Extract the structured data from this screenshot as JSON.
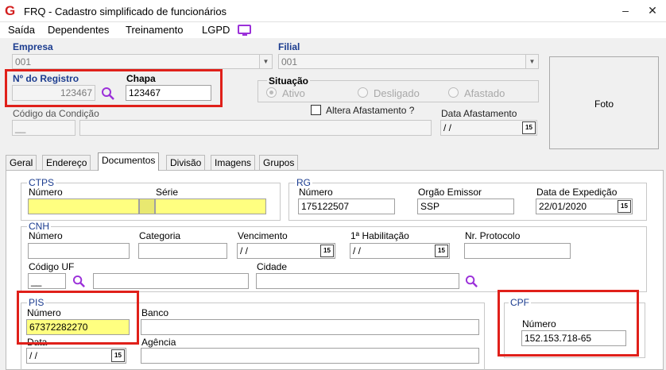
{
  "window": {
    "title": "FRQ - Cadastro simplificado de funcionários",
    "minimize": "–",
    "close": "✕"
  },
  "menu": [
    "Saída",
    "Dependentes",
    "Treinamento",
    "LGPD"
  ],
  "empresa": {
    "label": "Empresa",
    "value": "001"
  },
  "filial": {
    "label": "Filial",
    "value": "001"
  },
  "registro": {
    "label": "Nº do Registro",
    "value": "123467"
  },
  "chapa": {
    "label": "Chapa",
    "value": "123467"
  },
  "situacao": {
    "label": "Situação",
    "options": [
      "Ativo",
      "Desligado",
      "Afastado"
    ],
    "selected": "Ativo"
  },
  "codigo_condicao": {
    "label": "Código da Condição",
    "value": "__"
  },
  "altera_afastamento": {
    "label": "Altera Afastamento ?",
    "checked": false
  },
  "data_afastamento": {
    "label": "Data Afastamento",
    "value": " / /",
    "btn": "15"
  },
  "foto": {
    "label": "Foto"
  },
  "tabs": [
    "Geral",
    "Endereço",
    "Documentos",
    "Divisão",
    "Imagens",
    "Grupos"
  ],
  "active_tab": "Documentos",
  "ctps": {
    "title": "CTPS",
    "numero_label": "Número",
    "serie_label": "Série",
    "numero": "",
    "serie": ""
  },
  "rg": {
    "title": "RG",
    "numero_label": "Número",
    "numero": "175122507",
    "orgao_label": "Orgão Emissor",
    "orgao": "SSP",
    "data_label": "Data de Expedição",
    "data": "22/01/2020",
    "btn": "15"
  },
  "cnh": {
    "title": "CNH",
    "numero_label": "Número",
    "categoria_label": "Categoria",
    "vencimento_label": "Vencimento",
    "vencimento": " / /",
    "habilitacao_label": "1ª Habilitação",
    "habilitacao": " / /",
    "protocolo_label": "Nr. Protocolo",
    "codigo_uf_label": "Código UF",
    "codigo_uf": "__",
    "cidade_label": "Cidade",
    "btn": "15"
  },
  "pis": {
    "title": "PIS",
    "numero_label": "Número",
    "numero": "67372282270",
    "banco_label": "Banco",
    "data_label": "Data",
    "data": " / /",
    "agencia_label": "Agência",
    "btn": "15"
  },
  "cpf": {
    "title": "CPF",
    "numero_label": "Número",
    "numero": "152.153.718-65"
  },
  "colors": {
    "highlight": "#e0201a",
    "label_blue": "#1b3c8f",
    "lgpd": "#9b30d9",
    "search": "#9b30d9",
    "required": "#ffff80"
  }
}
